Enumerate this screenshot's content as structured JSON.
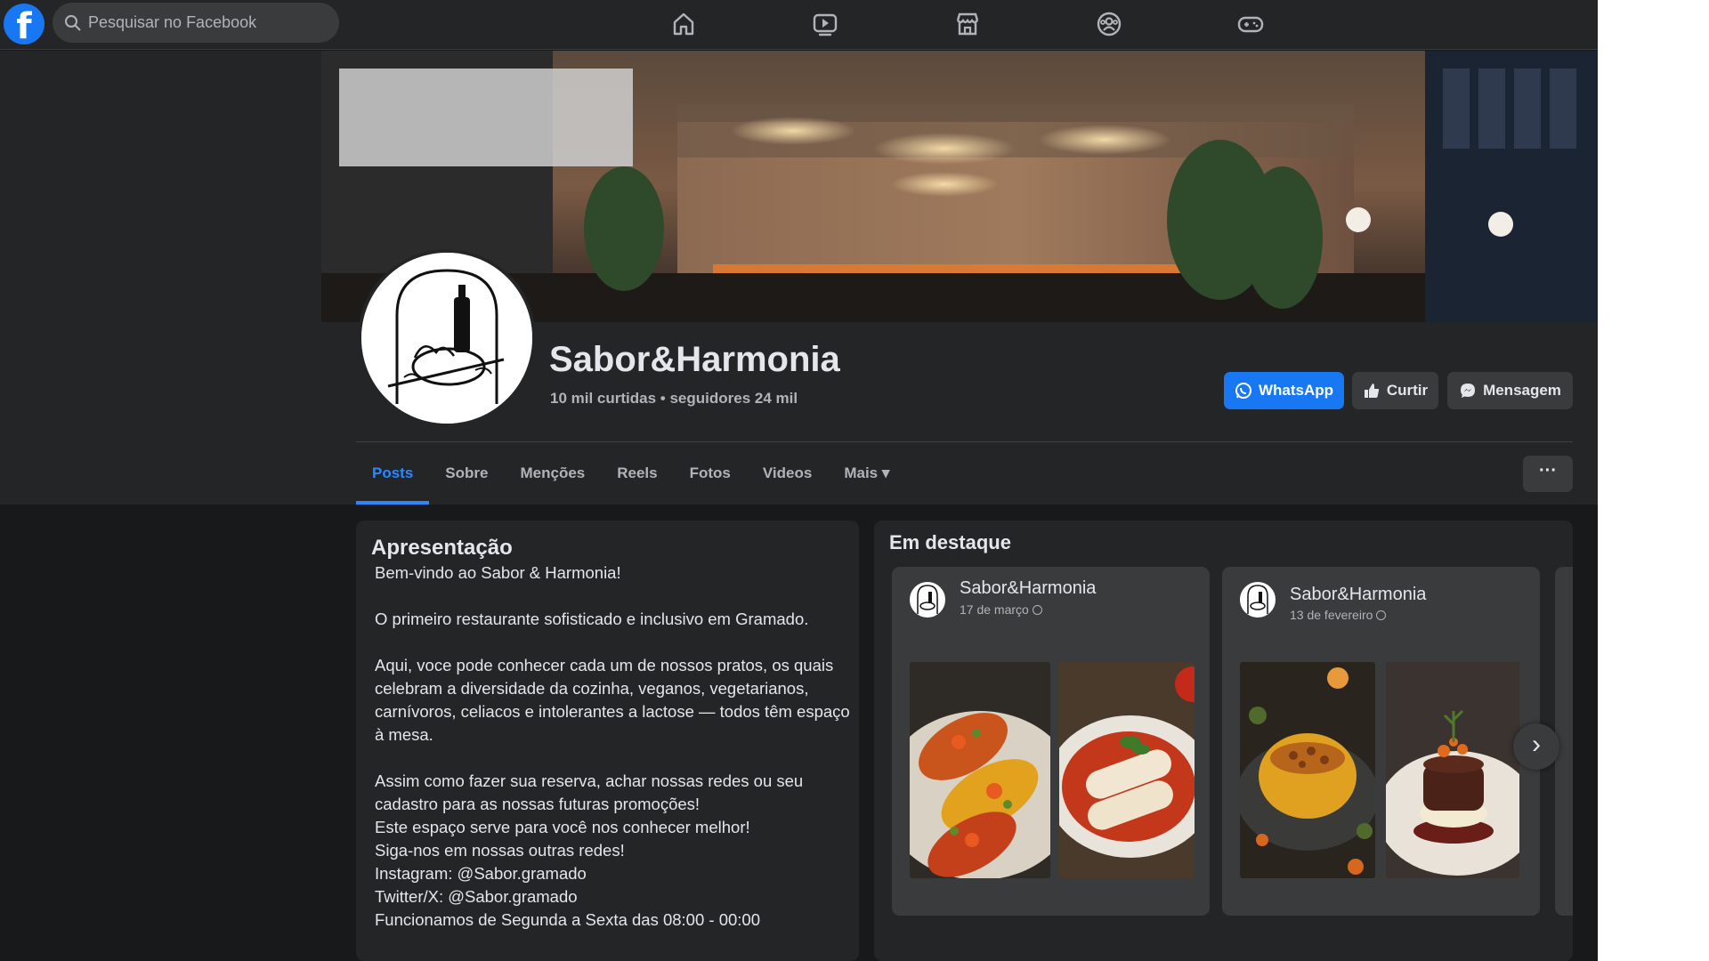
{
  "topbar": {
    "logo_letter": "f",
    "search_placeholder": "Pesquisar no Facebook",
    "nav_icons": [
      "home-icon",
      "watch-icon",
      "marketplace-icon",
      "groups-icon",
      "gaming-icon"
    ]
  },
  "page": {
    "name": "Sabor&Harmonia",
    "stats": "10 mil curtidas • seguidores 24 mil"
  },
  "actions": {
    "whatsapp": "WhatsApp",
    "like": "Curtir",
    "message": "Mensagem"
  },
  "tabs": [
    {
      "label": "Posts",
      "active": true
    },
    {
      "label": "Sobre"
    },
    {
      "label": "Menções"
    },
    {
      "label": "Reels"
    },
    {
      "label": "Fotos"
    },
    {
      "label": "Videos"
    },
    {
      "label": "Mais ▾"
    }
  ],
  "more_label": "···",
  "intro": {
    "title": "Apresentação",
    "bio": "Bem-vindo ao Sabor & Harmonia!\n\nO primeiro restaurante sofisticado e inclusivo em Gramado.\n\nAqui, voce pode conhecer cada um de nossos pratos, os quais celebram a diversidade da cozinha, veganos, vegetarianos, carnívoros, celiacos e intolerantes a lactose — todos têm espaço à mesa.\n\nAssim como fazer sua reserva, achar nossas redes ou seu cadastro para as nossas futuras promoções!\nEste espaço serve para você nos conhecer melhor!\nSiga-nos em nossas outras redes!\nInstagram: @Sabor.gramado\nTwitter/X:  @Sabor.gramado\nFuncionamos de Segunda a Sexta das 08:00 - 00:00"
  },
  "featured": {
    "title": "Em destaque",
    "posts": [
      {
        "author": "Sabor&Harmonia",
        "date": "17 de março"
      },
      {
        "author": "Sabor&Harmonia",
        "date": "13 de fevereiro"
      }
    ],
    "next_label": "›"
  },
  "colors": {
    "accent": "#1877f2",
    "link_active": "#2d88ff",
    "background": "#18191a",
    "card": "#242526",
    "text": "#e4e6eb",
    "muted": "#b0b3b8"
  }
}
